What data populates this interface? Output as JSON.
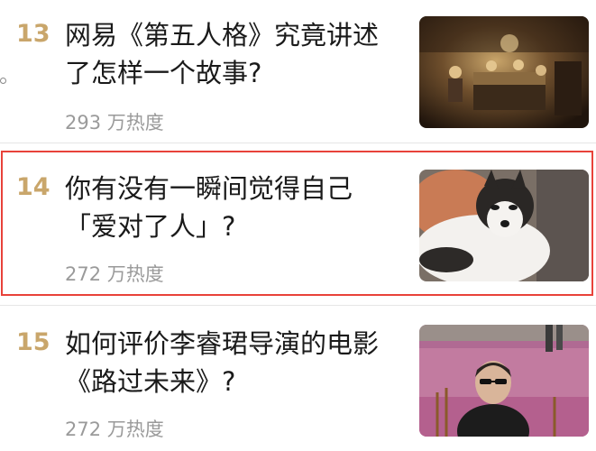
{
  "hot_list": {
    "items": [
      {
        "rank": "13",
        "title_line1": "网易《第五人格》究竟讲述",
        "title_line2": "了怎样一个故事?",
        "heat": "293 万热度",
        "thumbnail": "game-dinner-scene-image"
      },
      {
        "rank": "14",
        "title_line1": "你有没有一瞬间觉得自己",
        "title_line2": "「爱对了人」?",
        "heat": "272 万热度",
        "thumbnail": "husky-dog-image"
      },
      {
        "rank": "15",
        "title_line1": "如何评价李睿珺导演的电影",
        "title_line2": "《路过未来》?",
        "heat": "272 万热度",
        "thumbnail": "red-carpet-man-image"
      }
    ]
  },
  "colors": {
    "rank": "#c9a66b",
    "title": "#1a1a1a",
    "heat": "#9a9a9a",
    "highlight_border": "#e8423a"
  }
}
